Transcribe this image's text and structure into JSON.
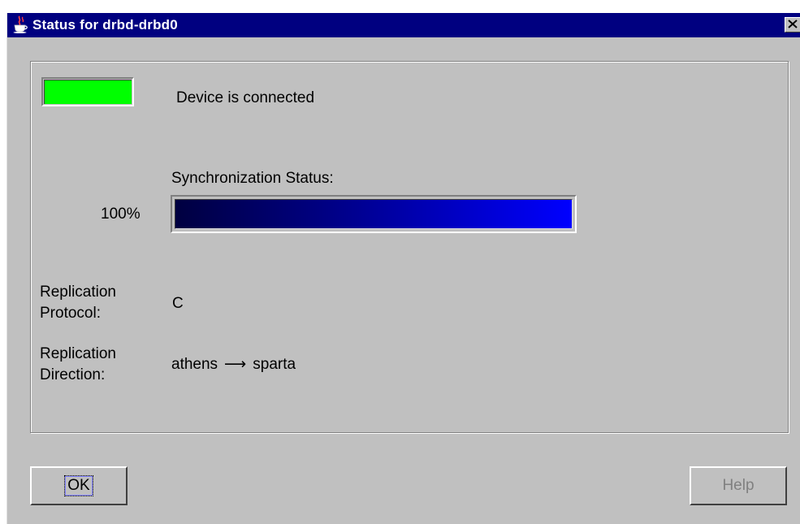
{
  "window": {
    "title": "Status for drbd-drbd0",
    "app_icon": "java-cup-icon",
    "close_icon": "close-icon"
  },
  "status": {
    "indicator_color": "#00ff00",
    "connection_text": "Device is connected"
  },
  "sync": {
    "label": "Synchronization Status:",
    "percent_text": "100%",
    "progress_fraction": 1.0,
    "bar_color_start": "#000040",
    "bar_color_end": "#0000ff"
  },
  "replication": {
    "protocol_label_line1": "Replication",
    "protocol_label_line2": "Protocol:",
    "protocol_value": "C",
    "direction_label_line1": "Replication",
    "direction_label_line2": "Direction:",
    "direction_from": "athens",
    "direction_arrow": "⟶",
    "direction_to": "sparta"
  },
  "buttons": {
    "ok_label": "OK",
    "help_label": "Help"
  }
}
